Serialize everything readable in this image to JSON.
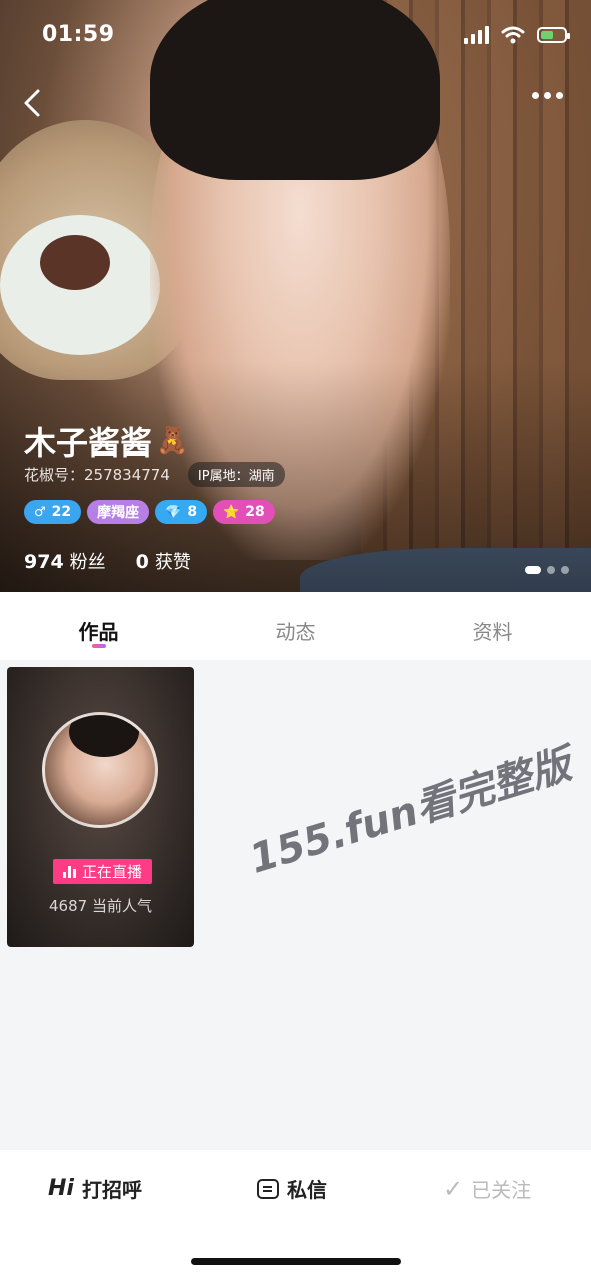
{
  "status": {
    "time": "01:59"
  },
  "profile": {
    "name": "木子酱酱",
    "name_emoji": "🧸",
    "id_label": "花椒号：257834774",
    "ip_label": "IP属地：湖南",
    "badges": [
      {
        "icon": "♂",
        "text": "22"
      },
      {
        "icon": "",
        "text": "摩羯座"
      },
      {
        "icon": "💎",
        "text": "8"
      },
      {
        "icon": "⭐",
        "text": "28"
      }
    ],
    "fans_count": "974",
    "fans_label": "粉丝",
    "likes_count": "0",
    "likes_label": "获赞"
  },
  "tabs": [
    "作品",
    "动态",
    "资料"
  ],
  "live_card": {
    "live_label": "正在直播",
    "popularity": "4687 当前人气"
  },
  "watermark": "155.fun看完整版",
  "bottom_bar": {
    "greet_icon": "Hi",
    "greet_label": "打招呼",
    "message_label": "私信",
    "follow_label": "已关注"
  },
  "colors": {
    "accent": "#ff3b86",
    "live_badge": "#ff3b86"
  }
}
